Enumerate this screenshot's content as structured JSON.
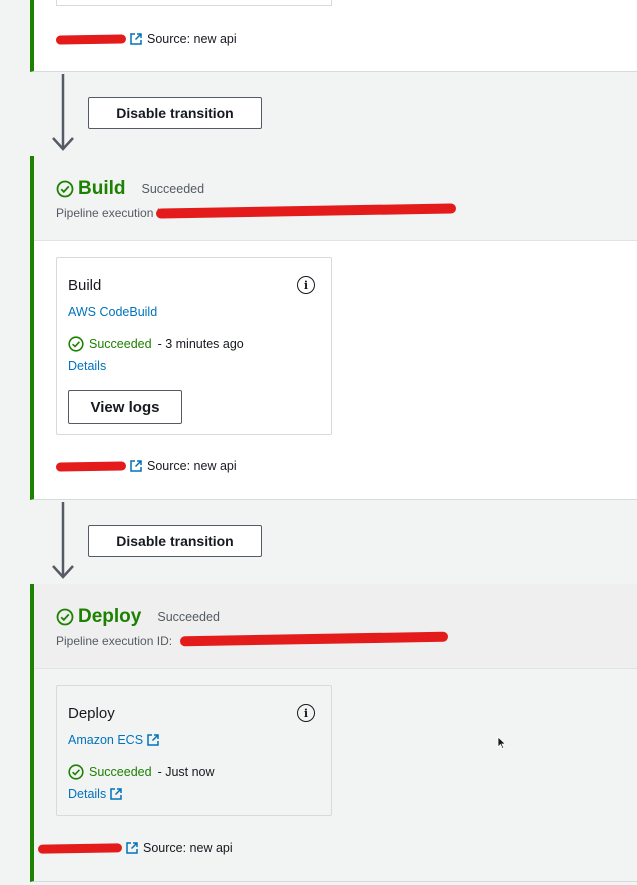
{
  "top_stage": {
    "source_label": "Source: new api"
  },
  "transitions": [
    {
      "button_label": "Disable transition"
    },
    {
      "button_label": "Disable transition"
    }
  ],
  "build_stage": {
    "title": "Build",
    "status": "Succeeded",
    "exec_label": "Pipeline execution ID:",
    "exec_value": "",
    "action": {
      "title": "Build",
      "provider": "AWS CodeBuild",
      "status": "Succeeded",
      "time": "- 3 minutes ago",
      "details": "Details",
      "view_logs": "View logs"
    },
    "source_label": "Source: new api"
  },
  "deploy_stage": {
    "title": "Deploy",
    "status": "Succeeded",
    "exec_label": "Pipeline execution ID:",
    "exec_value": "",
    "action": {
      "title": "Deploy",
      "provider": "Amazon ECS",
      "status": "Succeeded",
      "time": "- Just now",
      "details": "Details"
    },
    "source_label": "Source: new api"
  },
  "colors": {
    "success_green": "#1d8102",
    "link_blue": "#0073bb",
    "redaction_red": "#e31b1b"
  }
}
